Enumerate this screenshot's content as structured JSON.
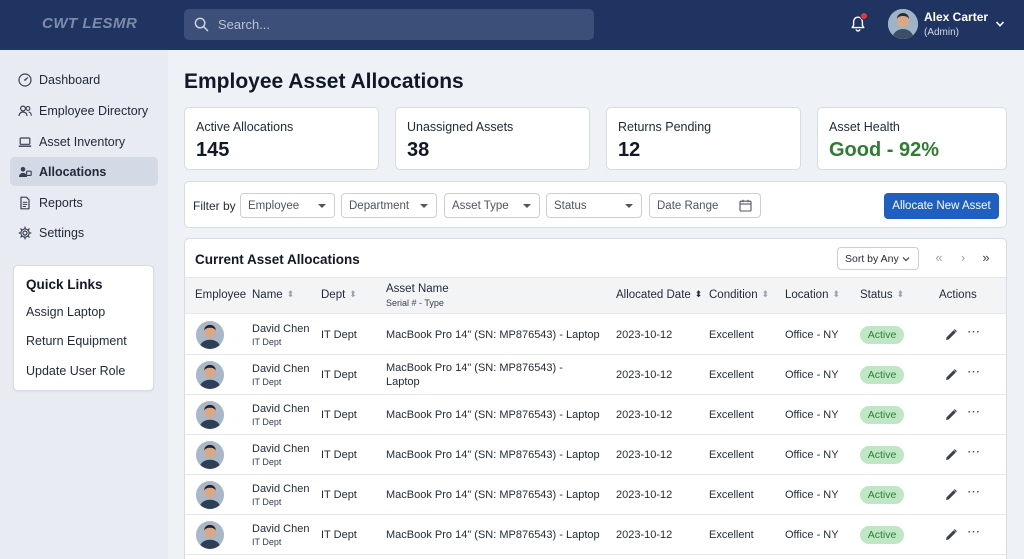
{
  "header": {
    "logo_text": "CWT LESMR",
    "search_placeholder": "Search...",
    "notification_count": "1",
    "user_name": "Alex Carter",
    "user_role": "(Admin)"
  },
  "sidebar": {
    "items": [
      {
        "label": "Dashboard",
        "icon": "dashboard-icon"
      },
      {
        "label": "Employee Directory",
        "icon": "users-icon"
      },
      {
        "label": "Asset Inventory",
        "icon": "laptop-icon"
      },
      {
        "label": "Allocations",
        "icon": "allocation-icon",
        "active": true
      },
      {
        "label": "Reports",
        "icon": "document-icon"
      },
      {
        "label": "Settings",
        "icon": "gear-icon"
      }
    ],
    "quick_links": {
      "title": "Quick Links",
      "items": [
        "Assign Laptop",
        "Return Equipment",
        "Update User Role"
      ]
    }
  },
  "main": {
    "title": "Employee Asset Allocations",
    "stats": [
      {
        "label": "Active Allocations",
        "value": "145"
      },
      {
        "label": "Unassigned Assets",
        "value": "38"
      },
      {
        "label": "Returns Pending",
        "value": "12"
      },
      {
        "label": "Asset Health",
        "value": "Good - 92%",
        "color": "#2e7d32"
      }
    ],
    "filters": {
      "label": "Filter by",
      "employee": "Employee",
      "department": "Department",
      "asset_type": "Asset Type",
      "status": "Status",
      "date_range": "Date Range",
      "allocate_button": "Allocate New Asset"
    },
    "table": {
      "title": "Current Asset Allocations",
      "sort_label": "Sort by Any",
      "columns": {
        "employee": "Employee",
        "name": "Name",
        "dept": "Dept",
        "asset": "Asset Name",
        "asset_sub": "Serial # - Type",
        "date": "Allocated Date",
        "condition": "Condition",
        "location": "Location",
        "status": "Status",
        "actions": "Actions"
      },
      "rows": [
        {
          "name": "David Chen",
          "dept_sub": "IT Dept",
          "dept": "IT Dept",
          "asset": "MacBook Pro 14\" (SN: MP876543) - Laptop",
          "date": "2023-10-12",
          "condition": "Excellent",
          "location": "Office - NY",
          "status": "Active"
        },
        {
          "name": "David Chen",
          "dept_sub": "IT Dept",
          "dept": "IT Dept",
          "asset": "MacBook Pro 14\" (SN: MP876543) - Laptop",
          "date": "2023-10-12",
          "condition": "Excellent",
          "location": "Office - NY",
          "status": "Active"
        },
        {
          "name": "David Chen",
          "dept_sub": "IT Dept",
          "dept": "IT Dept",
          "asset": "MacBook Pro 14\" (SN: MP876543) - Laptop",
          "date": "2023-10-12",
          "condition": "Excellent",
          "location": "Office - NY",
          "status": "Active"
        },
        {
          "name": "David Chen",
          "dept_sub": "IT Dept",
          "dept": "IT Dept",
          "asset": "MacBook Pro 14\" (SN: MP876543) - Laptop",
          "date": "2023-10-12",
          "condition": "Excellent",
          "location": "Office - NY",
          "status": "Active"
        },
        {
          "name": "David Chen",
          "dept_sub": "IT Dept",
          "dept": "IT Dept",
          "asset": "MacBook Pro 14\" (SN: MP876543) - Laptop",
          "date": "2023-10-12",
          "condition": "Excellent",
          "location": "Office - NY",
          "status": "Active"
        },
        {
          "name": "David Chen",
          "dept_sub": "IT Dept",
          "dept": "IT Dept",
          "asset": "MacBook Pro 14\" (SN: MP876543) - Laptop",
          "date": "2023-10-12",
          "condition": "Excellent",
          "location": "Office - NY",
          "status": "Active"
        }
      ]
    }
  },
  "colors": {
    "header_bg": "#1f3461",
    "primary": "#1f5fbf",
    "good": "#2e7d32",
    "badge_bg": "#bfe7c6"
  }
}
